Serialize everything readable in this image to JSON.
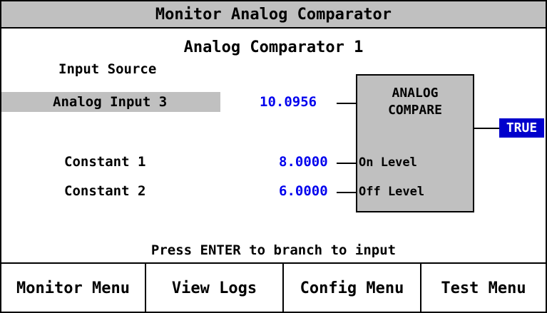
{
  "window": {
    "title": "Monitor Analog Comparator"
  },
  "comparator": {
    "name": "Analog Comparator 1"
  },
  "inputs": {
    "source_header": "Input Source",
    "analog_input": {
      "label": "Analog Input 3",
      "value": "10.0956"
    },
    "constant_1": {
      "label": "Constant 1",
      "value": "8.0000"
    },
    "constant_2": {
      "label": "Constant 2",
      "value": "6.0000"
    }
  },
  "block": {
    "title_line1": "ANALOG",
    "title_line2": "COMPARE",
    "on_level": "On Level",
    "off_level": "Off Level"
  },
  "output": {
    "state": "TRUE"
  },
  "hint": "Press ENTER to branch to input",
  "menu": {
    "monitor": "Monitor Menu",
    "view_logs": "View Logs",
    "config": "Config Menu",
    "test": "Test Menu"
  },
  "colors": {
    "value_text": "#0000ee",
    "status_badge_bg": "#0000cc",
    "panel_gray": "#c0c0c0"
  }
}
